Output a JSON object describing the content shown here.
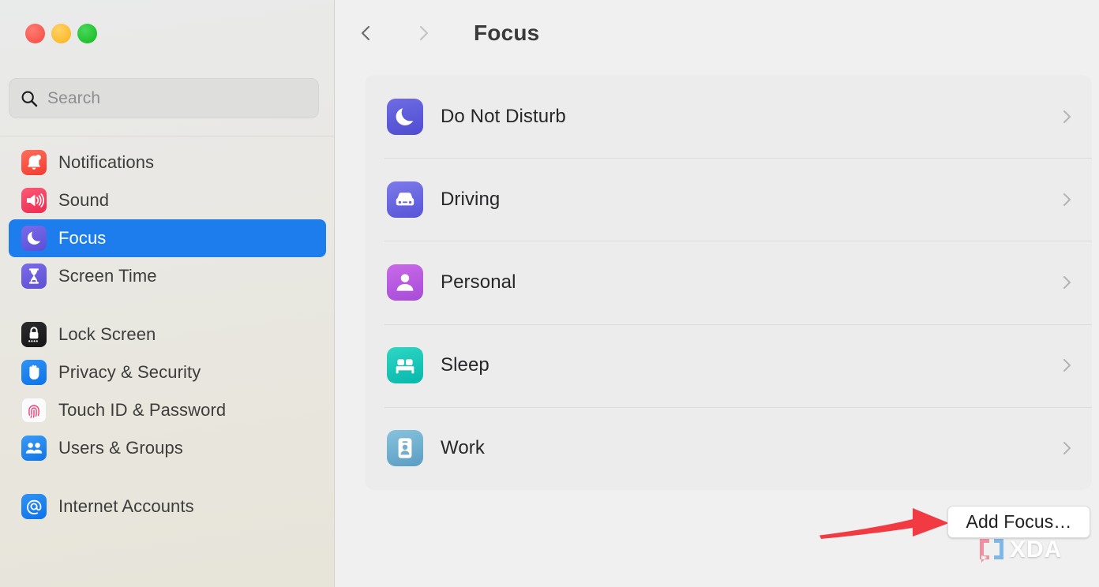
{
  "window": {
    "traffic_lights": [
      {
        "name": "close",
        "color": "#f9574f"
      },
      {
        "name": "minimize",
        "color": "#fcbc2e"
      },
      {
        "name": "maximize",
        "color": "#22c12f"
      }
    ]
  },
  "search": {
    "placeholder": "Search",
    "value": "",
    "icon": "search-icon"
  },
  "sidebar": {
    "groups": [
      {
        "items": [
          {
            "label": "Notifications",
            "icon": "bell-icon",
            "icon_class": "ic-notifications",
            "selected": false
          },
          {
            "label": "Sound",
            "icon": "speaker-icon",
            "icon_class": "ic-sound",
            "selected": false
          },
          {
            "label": "Focus",
            "icon": "moon-icon",
            "icon_class": "ic-focus",
            "selected": true
          },
          {
            "label": "Screen Time",
            "icon": "hourglass-icon",
            "icon_class": "ic-screentime",
            "selected": false
          }
        ]
      },
      {
        "items": [
          {
            "label": "Lock Screen",
            "icon": "lock-icon",
            "icon_class": "ic-lockscreen",
            "selected": false
          },
          {
            "label": "Privacy & Security",
            "icon": "hand-icon",
            "icon_class": "ic-privacy",
            "selected": false
          },
          {
            "label": "Touch ID & Password",
            "icon": "fingerprint-icon",
            "icon_class": "ic-touchid",
            "selected": false
          },
          {
            "label": "Users & Groups",
            "icon": "people-icon",
            "icon_class": "ic-users",
            "selected": false
          }
        ]
      },
      {
        "items": [
          {
            "label": "Internet Accounts",
            "icon": "at-sign-icon",
            "icon_class": "ic-internet",
            "selected": false
          }
        ]
      }
    ],
    "selection_color": "#1d7ded"
  },
  "toolbar": {
    "back_icon": "chevron-left-icon",
    "forward_icon": "chevron-right-icon",
    "back_enabled": true,
    "forward_enabled": false,
    "title": "Focus"
  },
  "main": {
    "focus_list": [
      {
        "label": "Do Not Disturb",
        "icon": "moon-icon",
        "icon_class": "ic-dnd",
        "chevron": "chevron-right-icon"
      },
      {
        "label": "Driving",
        "icon": "car-icon",
        "icon_class": "ic-driving",
        "chevron": "chevron-right-icon"
      },
      {
        "label": "Personal",
        "icon": "person-icon",
        "icon_class": "ic-personal",
        "chevron": "chevron-right-icon"
      },
      {
        "label": "Sleep",
        "icon": "bed-icon",
        "icon_class": "ic-sleep",
        "chevron": "chevron-right-icon"
      },
      {
        "label": "Work",
        "icon": "id-badge-icon",
        "icon_class": "ic-work",
        "chevron": "chevron-right-icon"
      }
    ],
    "add_focus_label": "Add Focus…"
  },
  "annotation": {
    "arrow_color": "#f23a43",
    "arrow_points_to": "add-focus-button"
  },
  "watermark": {
    "text": "XDA",
    "bubble_color": "#ef8fa0",
    "bracket_color": "#7fb8e8"
  }
}
